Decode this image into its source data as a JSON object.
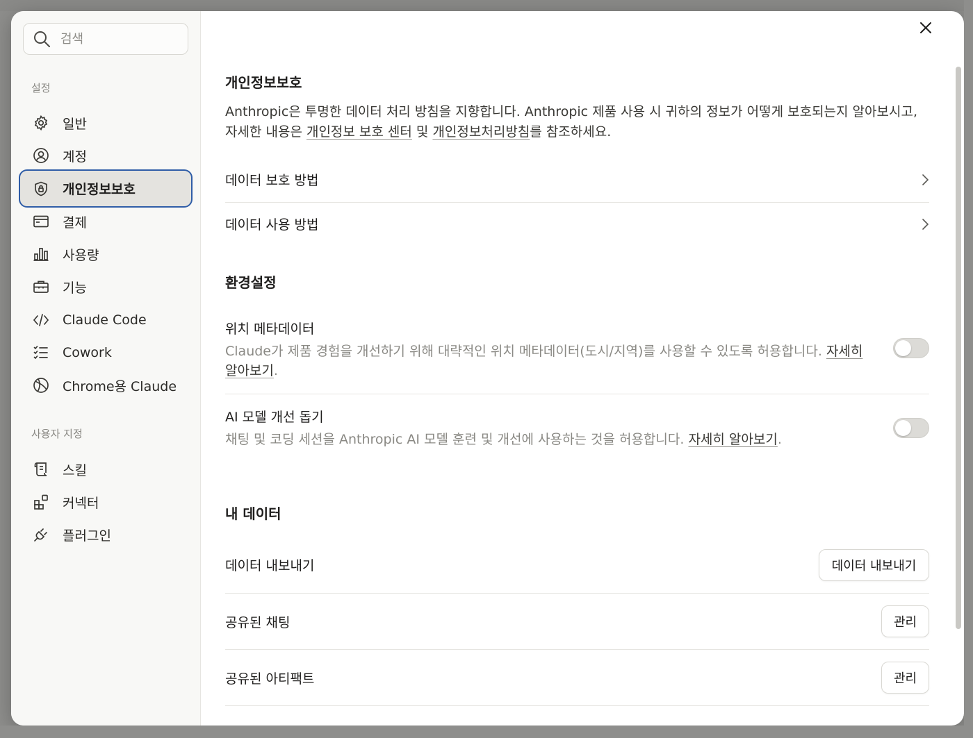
{
  "search": {
    "placeholder": "검색"
  },
  "sidebar": {
    "settings_label": "설정",
    "items": [
      {
        "label": "일반",
        "icon": "gear-icon"
      },
      {
        "label": "계정",
        "icon": "user-circle-icon"
      },
      {
        "label": "개인정보보호",
        "icon": "shield-lock-icon",
        "active": true
      },
      {
        "label": "결제",
        "icon": "credit-card-icon"
      },
      {
        "label": "사용량",
        "icon": "bar-chart-icon"
      },
      {
        "label": "기능",
        "icon": "briefcase-icon"
      },
      {
        "label": "Claude Code",
        "icon": "code-icon"
      },
      {
        "label": "Cowork",
        "icon": "task-list-icon"
      },
      {
        "label": "Chrome용 Claude",
        "icon": "globe-icon"
      }
    ],
    "custom_label": "사용자 지정",
    "custom_items": [
      {
        "label": "스킬",
        "icon": "scroll-icon"
      },
      {
        "label": "커넥터",
        "icon": "blocks-icon"
      },
      {
        "label": "플러그인",
        "icon": "plug-icon"
      }
    ]
  },
  "privacy": {
    "title": "개인정보보호",
    "intro_part1": "Anthropic은 투명한 데이터 처리 방침을 지향합니다. Anthropic 제품 사용 시 귀하의 정보가 어떻게 보호되는지 알아보시고, 자세한 내용은 ",
    "privacy_center_link": "개인정보 보호 센터",
    "intro_part2": " 및 ",
    "privacy_policy_link": "개인정보처리방침",
    "intro_part3": "를 참조하세요.",
    "links": [
      {
        "label": "데이터 보호 방법"
      },
      {
        "label": "데이터 사용 방법"
      }
    ]
  },
  "preferences": {
    "title": "환경설정",
    "location": {
      "title": "위치 메타데이터",
      "desc": "Claude가 제품 경험을 개선하기 위해 대략적인 위치 메타데이터(도시/지역)를 사용할 수 있도록 허용합니다. ",
      "learn_more": "자세히 알아보기",
      "enabled": false
    },
    "model_improvement": {
      "title": "AI 모델 개선 돕기",
      "desc": "채팅 및 코딩 세션을 Anthropic AI 모델 훈련 및 개선에 사용하는 것을 허용합니다. ",
      "learn_more": "자세히 알아보기",
      "enabled": false
    }
  },
  "my_data": {
    "title": "내 데이터",
    "rows": [
      {
        "label": "데이터 내보내기",
        "button": "데이터 내보내기"
      },
      {
        "label": "공유된 채팅",
        "button": "관리"
      },
      {
        "label": "공유된 아티팩트",
        "button": "관리"
      }
    ]
  },
  "colors": {
    "active_outline": "#2f5da7",
    "sidebar_bg": "#f8f8f6",
    "muted_text": "#8a8984"
  }
}
